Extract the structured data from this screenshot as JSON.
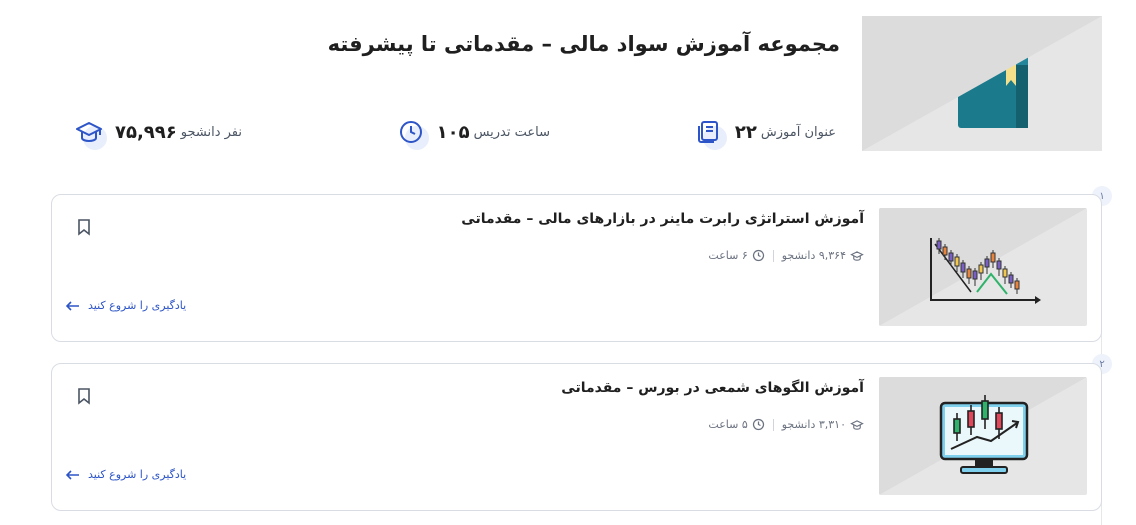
{
  "collection": {
    "title": "مجموعه آموزش سواد مالی – مقدماتی تا پیشرفته",
    "thumbnail_icon": "book-with-coin-icon"
  },
  "stats": {
    "lessons": {
      "value": "۲۲",
      "label": "عنوان آموزش",
      "icon": "book-stack-icon"
    },
    "hours": {
      "value": "۱۰۵",
      "label": "ساعت تدریس",
      "icon": "clock-icon"
    },
    "students": {
      "value": "۷۵,۹۹۶",
      "label": "نفر دانشجو",
      "icon": "graduation-cap-icon"
    }
  },
  "courses": [
    {
      "step": "۱",
      "title": "آموزش استراتژی رابرت ماینر در بازارهای مالی – مقدماتی",
      "students": "۹,۳۶۴ دانشجو",
      "duration": "۶ ساعت",
      "cta": "یادگیری را شروع کنید",
      "thumbnail_icon": "candlestick-chart-icon"
    },
    {
      "step": "۲",
      "title": "آموزش الگوهای شمعی در بورس – مقدماتی",
      "students": "۳,۳۱۰ دانشجو",
      "duration": "۵ ساعت",
      "cta": "یادگیری را شروع کنید",
      "thumbnail_icon": "monitor-candlestick-icon"
    }
  ],
  "colors": {
    "accent": "#2d55c7",
    "thumb_bg": "#e6e6e6",
    "book": "#1b7a8c",
    "coin": "#f5a623"
  }
}
